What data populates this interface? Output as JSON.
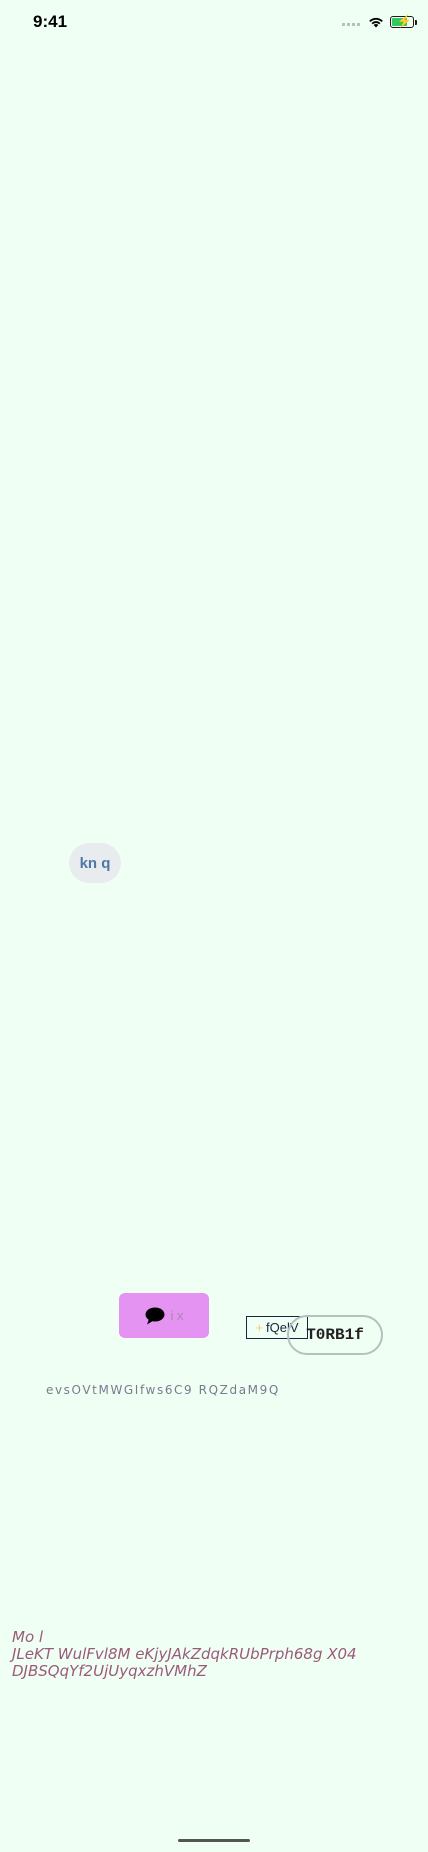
{
  "status_bar": {
    "time": "9:41",
    "battery_level": 0.8,
    "battery_color": "#34c759"
  },
  "chip": {
    "label": "kn q"
  },
  "message_button": {
    "icon": "speech-bubble-icon",
    "label": "i x"
  },
  "outlined_tag": {
    "icon": "plus-icon",
    "label": "fQelV"
  },
  "pill_button": {
    "label": "T0RB1f"
  },
  "caption": {
    "text": "evsOVtMWGIfws6C9 RQZdaM9Q"
  },
  "footer": {
    "line1": "Mo l",
    "line2": "JLeKT WulFvl8M eKjyJAkZdqkRUbPrph68g X04",
    "line3": "DJBSQqYf2UjUyqxzhVMhZ"
  }
}
